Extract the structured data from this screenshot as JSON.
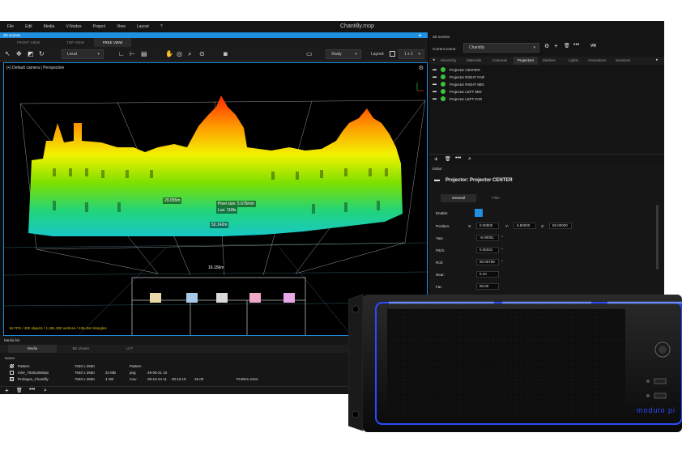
{
  "window_title": "Chantilly.mop",
  "menu": [
    "File",
    "Edit",
    "Media",
    "V-Nodes",
    "Project",
    "View",
    "Layout",
    "?"
  ],
  "scene_view": {
    "panel_title": "3D scenes",
    "tabs": [
      "FRONT VIEW",
      "TOP VIEW",
      "FREE VIEW"
    ],
    "active_tab": "FREE VIEW",
    "toolbar": {
      "space_mode": "Local",
      "study": "Study",
      "layout_label": "Layout:",
      "layout_value": "1 x 1"
    },
    "camera_label": "[+] Default camera | Perspective",
    "measurements": [
      "29.055m",
      "Pixel size: 5.675mm",
      "Lux: 118lx",
      "52.142m",
      "16.156m"
    ],
    "stats": "16 FPS / 400 objects / 1,381,300 vertices / 436,294 triangles"
  },
  "media_list": {
    "title": "Media list",
    "tabs": [
      "Media",
      "BE shader",
      "LUT"
    ],
    "active_tab": "Media",
    "column_header": "Name",
    "rows": [
      {
        "name": "Pattern",
        "res": "7040 x 2560",
        "size": "",
        "type": "Pattern",
        "date": "",
        "dur": "",
        "profile": ""
      },
      {
        "name": "mire_7040x2560px",
        "res": "7040 x 2560",
        "size": "24 MB",
        "type": "png",
        "date": "29-06-21 15",
        "dur": "",
        "profile": ""
      },
      {
        "name": "Prologue_Chantilly",
        "res": "7040 x 2560",
        "size": "4 GB",
        "type": "mov",
        "date": "09-10-24 11",
        "dur": "00:10:19",
        "fps": "25.00",
        "profile": "ProRes 4444"
      }
    ]
  },
  "scenes_panel": {
    "title": "3D scenes",
    "current_scene_label": "Current scene:",
    "current_scene": "Chantilly",
    "vr": "VR",
    "tabs": [
      "Hierarchy",
      "Materials",
      "Cameras",
      "Projectors",
      "Meshes",
      "Lights",
      "Animations",
      "Sessions"
    ],
    "active_tab": "Projectors",
    "projectors": [
      "Projector CENTER",
      "Projector RIGHT FAR",
      "Projector RIGHT MID",
      "Projector LEFT MID",
      "Projector LEFT FAR"
    ]
  },
  "editor": {
    "title": "Editor",
    "header": "Projector: Projector CENTER",
    "tabs": [
      "General",
      "Filter"
    ],
    "active_tab": "General",
    "enable_label": "Enable:",
    "position_label": "Position:",
    "position": {
      "x_label": "X:",
      "x": "0.00000",
      "y_label": "Y:",
      "y": "6.80000",
      "z_label": "Z:",
      "z": "50.00000"
    },
    "fields": [
      {
        "label": "Yaw:",
        "value": "-6.00001",
        "unit": "°"
      },
      {
        "label": "Pitch:",
        "value": "0.00331",
        "unit": "°"
      },
      {
        "label": "Roll:",
        "value": "90.00759",
        "unit": "°"
      },
      {
        "label": "Near:",
        "value": "0.10",
        "unit": ""
      },
      {
        "label": "Far:",
        "value": "90.00",
        "unit": ""
      }
    ],
    "pin_target_label": "Pin target:"
  },
  "hardware": {
    "brand": "modulo pi"
  },
  "colors": {
    "accent": "#1f8fe0",
    "enabled": "#3cc23c",
    "server_led": "#2a4cff"
  }
}
